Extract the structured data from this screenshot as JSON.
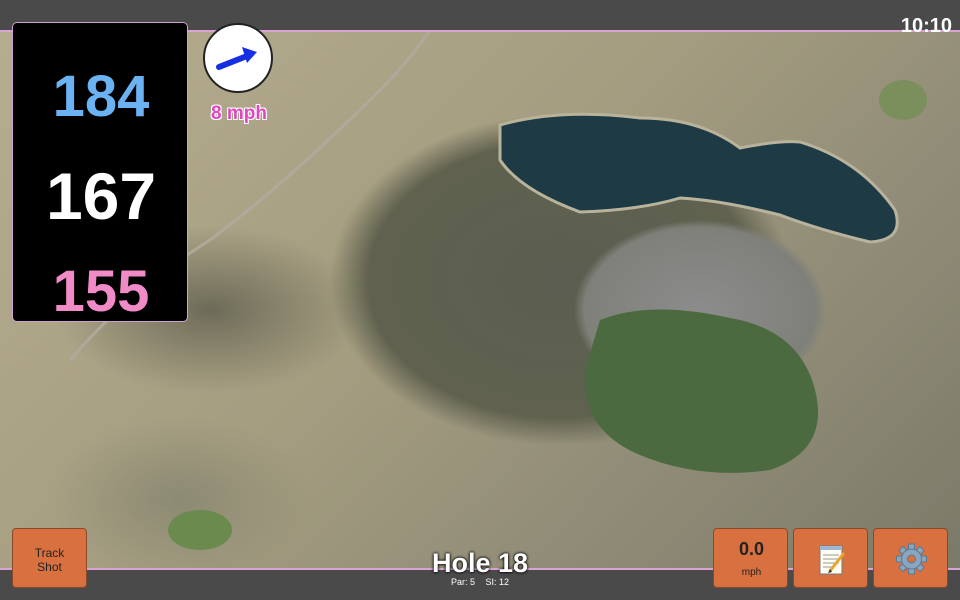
{
  "status": {
    "time": "10:10"
  },
  "distances": {
    "back": "184",
    "middle": "167",
    "front": "155"
  },
  "wind": {
    "speed_label": "8 mph",
    "icon": "wind-arrow-icon"
  },
  "buttons": {
    "track_shot_line1": "Track",
    "track_shot_line2": "Shot",
    "speed_value": "0.0",
    "speed_unit": "mph",
    "notes_icon": "notepad-icon",
    "settings_icon": "gear-icon"
  },
  "hole": {
    "title": "Hole 18",
    "par": "Par: 5",
    "si": "SI: 12"
  },
  "colors": {
    "back": "#6ab2f1",
    "middle": "#ffffff",
    "front": "#f08bc8",
    "button": "#d9703f",
    "wind_label": "#e046c0"
  }
}
